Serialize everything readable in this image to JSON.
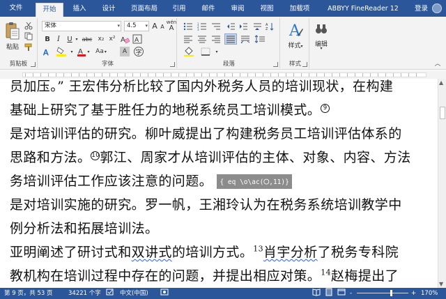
{
  "tabs": {
    "file": "文件",
    "items": [
      "开始",
      "插入",
      "设计",
      "页面布局",
      "引用",
      "邮件",
      "审阅",
      "视图",
      "加载项",
      "ABBYY FineReader 12"
    ],
    "active": "开始",
    "login": "登录"
  },
  "ribbon": {
    "clipboard": {
      "paste_label": "粘贴",
      "group_label": "剪贴板"
    },
    "font": {
      "font_name": "宋体",
      "font_size": "4.5",
      "grow": "A",
      "shrink": "A",
      "aa": "Aa",
      "wen": "wén",
      "bold": "B",
      "italic": "I",
      "underline": "U",
      "strike": "abc",
      "subscript": "x₂",
      "superscript": "x²",
      "font_color": "A",
      "highlight_label": "ab",
      "char_shading": "A",
      "enclose": "字",
      "case_aa": "Aa",
      "group_label": "字体"
    },
    "paragraph": {
      "group_label": "段落"
    },
    "styles": {
      "styles_label": "样式",
      "group_label": "样式"
    },
    "editing": {
      "edit_label": "编辑"
    }
  },
  "document": {
    "lines": [
      {
        "text": "员加压。” 王宏伟分析比较了国内外税务人员的培训现状，在构建"
      },
      {
        "text": "基础上研究了基于胜任力的地税系统员工培训模式。",
        "note": "⑨"
      },
      {
        "text": "是对培训评估的研究。柳叶威提出了构建税务员工培训评估体系的"
      },
      {
        "pre_note": "⑩",
        "pre": "思路和方法。",
        "text": "郭江、周家才从培训评估的主体、对象、内容、方法"
      },
      {
        "text": "务培训评估工作应该注意的问题。",
        "field": "{ eq \\o\\ac(",
        "field_big": "○",
        "field_end": ",11)}"
      },
      {
        "text": "是对培训实施的研究。罗一帆，王湘玲认为在税务系统培训教学中"
      },
      {
        "text": "例分析法和拓展培训法。"
      },
      {
        "pre": "亚明阐述了研讨式和",
        "squig": "双讲式",
        "mid": "的培训方式。",
        "sup": "13",
        "squig2": "肖宇分析",
        "post": "了税务专科院"
      },
      {
        "text": "教机构在培训过程中存在的问题，并提出相应对策。",
        "sup": "14",
        "post": "赵梅提出了"
      }
    ]
  },
  "status": {
    "page": "第 9 页，共 53 页",
    "words": "34221 个字",
    "lang": "中文(中国)",
    "zoom": "170%",
    "zoom_minus": "-",
    "zoom_plus": "+"
  },
  "colors": {
    "brand": "#2b579a",
    "ribbon_bg": "#f3f3f3",
    "field_bg": "#8c8c8c"
  }
}
